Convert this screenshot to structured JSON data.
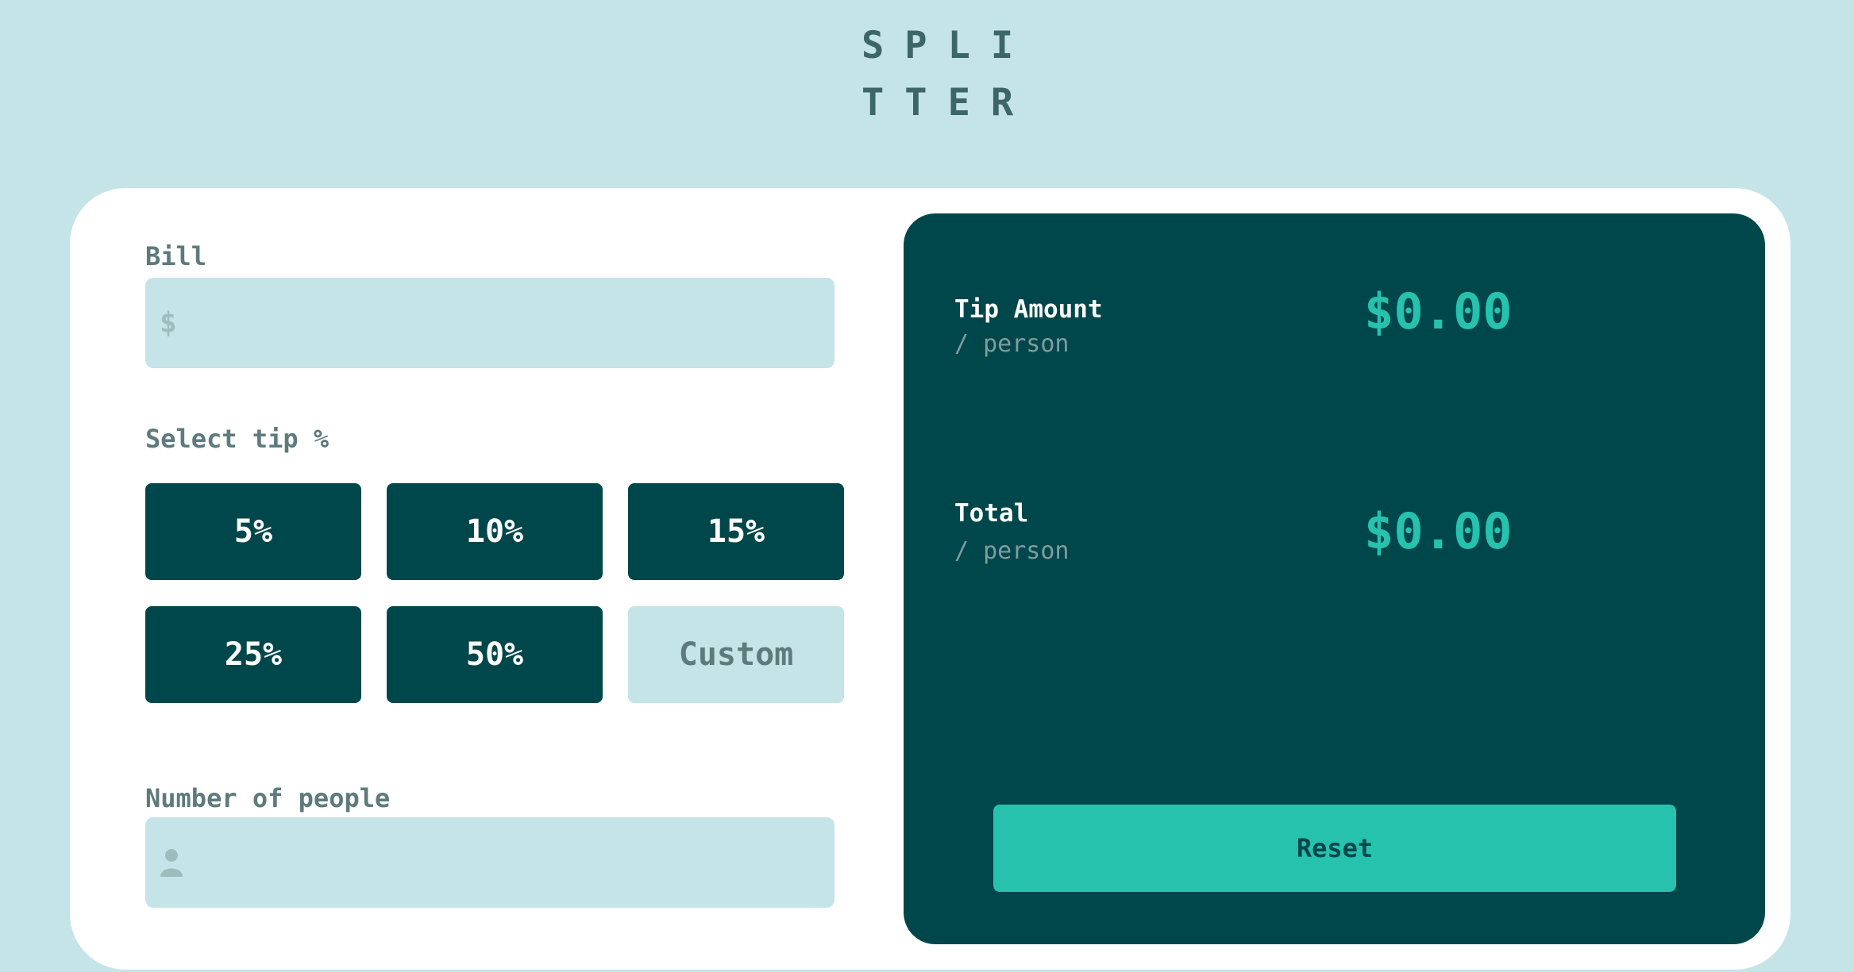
{
  "logo": {
    "line1": "SPLI",
    "line2": "TTER"
  },
  "bill": {
    "label": "Bill",
    "currency_icon": "dollar-icon",
    "currency_symbol": "$",
    "value": ""
  },
  "tip": {
    "label": "Select tip %",
    "options": [
      "5%",
      "10%",
      "15%",
      "25%",
      "50%"
    ],
    "custom_placeholder": "Custom"
  },
  "people": {
    "label": "Number of people",
    "icon": "person-icon",
    "value": ""
  },
  "results": {
    "tip_amount": {
      "title": "Tip Amount",
      "sub": "/ person",
      "value": "$0.00"
    },
    "total": {
      "title": "Total",
      "sub": "/ person",
      "value": "$0.00"
    },
    "reset_label": "Reset"
  },
  "colors": {
    "background": "#c5e4e7",
    "panel": "#00474b",
    "accent": "#26c2ae",
    "label": "#5e7a7d"
  }
}
